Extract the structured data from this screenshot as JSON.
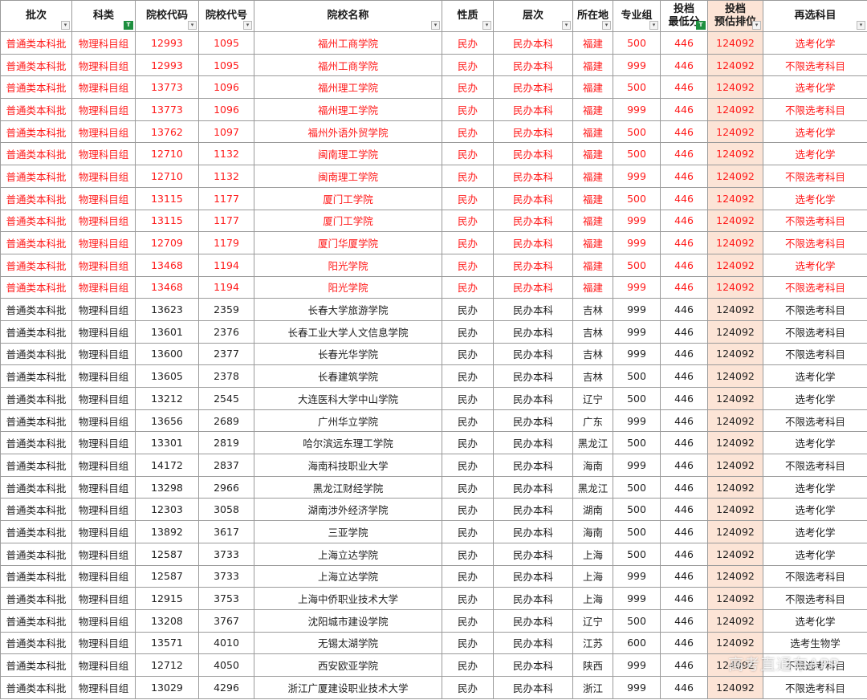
{
  "headers": [
    {
      "line1": "批次",
      "line2": "",
      "filter": "arrow"
    },
    {
      "line1": "科类",
      "line2": "",
      "filter": "active"
    },
    {
      "line1": "院校代码",
      "line2": "",
      "filter": "arrow"
    },
    {
      "line1": "院校代号",
      "line2": "",
      "filter": "arrow"
    },
    {
      "line1": "院校名称",
      "line2": "",
      "filter": "arrow"
    },
    {
      "line1": "性质",
      "line2": "",
      "filter": "arrow"
    },
    {
      "line1": "层次",
      "line2": "",
      "filter": "arrow"
    },
    {
      "line1": "所在地",
      "line2": "",
      "filter": "arrow"
    },
    {
      "line1": "专业组",
      "line2": "",
      "filter": "arrow"
    },
    {
      "line1": "投档",
      "line2": "最低分",
      "filter": "active"
    },
    {
      "line1": "投档",
      "line2": "预估排位",
      "filter": "arrow"
    },
    {
      "line1": "再选科目",
      "line2": "",
      "filter": "arrow"
    }
  ],
  "filter_icons": {
    "arrow": "▾",
    "active": "T"
  },
  "colors": {
    "highlight_text": "#ff1a1a",
    "rank_fill": "#fce4d6",
    "filter_active": "#1e8f3f"
  },
  "rows": [
    {
      "highlight": true,
      "cells": [
        "普通类本科批",
        "物理科目组",
        "12993",
        "1095",
        "福州工商学院",
        "民办",
        "民办本科",
        "福建",
        "500",
        "446",
        "124092",
        "选考化学"
      ]
    },
    {
      "highlight": true,
      "cells": [
        "普通类本科批",
        "物理科目组",
        "12993",
        "1095",
        "福州工商学院",
        "民办",
        "民办本科",
        "福建",
        "999",
        "446",
        "124092",
        "不限选考科目"
      ]
    },
    {
      "highlight": true,
      "cells": [
        "普通类本科批",
        "物理科目组",
        "13773",
        "1096",
        "福州理工学院",
        "民办",
        "民办本科",
        "福建",
        "500",
        "446",
        "124092",
        "选考化学"
      ]
    },
    {
      "highlight": true,
      "cells": [
        "普通类本科批",
        "物理科目组",
        "13773",
        "1096",
        "福州理工学院",
        "民办",
        "民办本科",
        "福建",
        "999",
        "446",
        "124092",
        "不限选考科目"
      ]
    },
    {
      "highlight": true,
      "cells": [
        "普通类本科批",
        "物理科目组",
        "13762",
        "1097",
        "福州外语外贸学院",
        "民办",
        "民办本科",
        "福建",
        "500",
        "446",
        "124092",
        "选考化学"
      ]
    },
    {
      "highlight": true,
      "cells": [
        "普通类本科批",
        "物理科目组",
        "12710",
        "1132",
        "闽南理工学院",
        "民办",
        "民办本科",
        "福建",
        "500",
        "446",
        "124092",
        "选考化学"
      ]
    },
    {
      "highlight": true,
      "cells": [
        "普通类本科批",
        "物理科目组",
        "12710",
        "1132",
        "闽南理工学院",
        "民办",
        "民办本科",
        "福建",
        "999",
        "446",
        "124092",
        "不限选考科目"
      ]
    },
    {
      "highlight": true,
      "cells": [
        "普通类本科批",
        "物理科目组",
        "13115",
        "1177",
        "厦门工学院",
        "民办",
        "民办本科",
        "福建",
        "500",
        "446",
        "124092",
        "选考化学"
      ]
    },
    {
      "highlight": true,
      "cells": [
        "普通类本科批",
        "物理科目组",
        "13115",
        "1177",
        "厦门工学院",
        "民办",
        "民办本科",
        "福建",
        "999",
        "446",
        "124092",
        "不限选考科目"
      ]
    },
    {
      "highlight": true,
      "cells": [
        "普通类本科批",
        "物理科目组",
        "12709",
        "1179",
        "厦门华厦学院",
        "民办",
        "民办本科",
        "福建",
        "999",
        "446",
        "124092",
        "不限选考科目"
      ]
    },
    {
      "highlight": true,
      "cells": [
        "普通类本科批",
        "物理科目组",
        "13468",
        "1194",
        "阳光学院",
        "民办",
        "民办本科",
        "福建",
        "500",
        "446",
        "124092",
        "选考化学"
      ]
    },
    {
      "highlight": true,
      "cells": [
        "普通类本科批",
        "物理科目组",
        "13468",
        "1194",
        "阳光学院",
        "民办",
        "民办本科",
        "福建",
        "999",
        "446",
        "124092",
        "不限选考科目"
      ]
    },
    {
      "highlight": false,
      "cells": [
        "普通类本科批",
        "物理科目组",
        "13623",
        "2359",
        "长春大学旅游学院",
        "民办",
        "民办本科",
        "吉林",
        "999",
        "446",
        "124092",
        "不限选考科目"
      ]
    },
    {
      "highlight": false,
      "cells": [
        "普通类本科批",
        "物理科目组",
        "13601",
        "2376",
        "长春工业大学人文信息学院",
        "民办",
        "民办本科",
        "吉林",
        "999",
        "446",
        "124092",
        "不限选考科目"
      ]
    },
    {
      "highlight": false,
      "cells": [
        "普通类本科批",
        "物理科目组",
        "13600",
        "2377",
        "长春光华学院",
        "民办",
        "民办本科",
        "吉林",
        "999",
        "446",
        "124092",
        "不限选考科目"
      ]
    },
    {
      "highlight": false,
      "cells": [
        "普通类本科批",
        "物理科目组",
        "13605",
        "2378",
        "长春建筑学院",
        "民办",
        "民办本科",
        "吉林",
        "500",
        "446",
        "124092",
        "选考化学"
      ]
    },
    {
      "highlight": false,
      "cells": [
        "普通类本科批",
        "物理科目组",
        "13212",
        "2545",
        "大连医科大学中山学院",
        "民办",
        "民办本科",
        "辽宁",
        "500",
        "446",
        "124092",
        "选考化学"
      ]
    },
    {
      "highlight": false,
      "cells": [
        "普通类本科批",
        "物理科目组",
        "13656",
        "2689",
        "广州华立学院",
        "民办",
        "民办本科",
        "广东",
        "999",
        "446",
        "124092",
        "不限选考科目"
      ]
    },
    {
      "highlight": false,
      "cells": [
        "普通类本科批",
        "物理科目组",
        "13301",
        "2819",
        "哈尔滨远东理工学院",
        "民办",
        "民办本科",
        "黑龙江",
        "500",
        "446",
        "124092",
        "选考化学"
      ]
    },
    {
      "highlight": false,
      "cells": [
        "普通类本科批",
        "物理科目组",
        "14172",
        "2837",
        "海南科技职业大学",
        "民办",
        "民办本科",
        "海南",
        "999",
        "446",
        "124092",
        "不限选考科目"
      ]
    },
    {
      "highlight": false,
      "cells": [
        "普通类本科批",
        "物理科目组",
        "13298",
        "2966",
        "黑龙江财经学院",
        "民办",
        "民办本科",
        "黑龙江",
        "500",
        "446",
        "124092",
        "选考化学"
      ]
    },
    {
      "highlight": false,
      "cells": [
        "普通类本科批",
        "物理科目组",
        "12303",
        "3058",
        "湖南涉外经济学院",
        "民办",
        "民办本科",
        "湖南",
        "500",
        "446",
        "124092",
        "选考化学"
      ]
    },
    {
      "highlight": false,
      "cells": [
        "普通类本科批",
        "物理科目组",
        "13892",
        "3617",
        "三亚学院",
        "民办",
        "民办本科",
        "海南",
        "500",
        "446",
        "124092",
        "选考化学"
      ]
    },
    {
      "highlight": false,
      "cells": [
        "普通类本科批",
        "物理科目组",
        "12587",
        "3733",
        "上海立达学院",
        "民办",
        "民办本科",
        "上海",
        "500",
        "446",
        "124092",
        "选考化学"
      ]
    },
    {
      "highlight": false,
      "cells": [
        "普通类本科批",
        "物理科目组",
        "12587",
        "3733",
        "上海立达学院",
        "民办",
        "民办本科",
        "上海",
        "999",
        "446",
        "124092",
        "不限选考科目"
      ]
    },
    {
      "highlight": false,
      "cells": [
        "普通类本科批",
        "物理科目组",
        "12915",
        "3753",
        "上海中侨职业技术大学",
        "民办",
        "民办本科",
        "上海",
        "999",
        "446",
        "124092",
        "不限选考科目"
      ]
    },
    {
      "highlight": false,
      "cells": [
        "普通类本科批",
        "物理科目组",
        "13208",
        "3767",
        "沈阳城市建设学院",
        "民办",
        "民办本科",
        "辽宁",
        "500",
        "446",
        "124092",
        "选考化学"
      ]
    },
    {
      "highlight": false,
      "cells": [
        "普通类本科批",
        "物理科目组",
        "13571",
        "4010",
        "无锡太湖学院",
        "民办",
        "民办本科",
        "江苏",
        "600",
        "446",
        "124092",
        "选考生物学"
      ]
    },
    {
      "highlight": false,
      "cells": [
        "普通类本科批",
        "物理科目组",
        "12712",
        "4050",
        "西安欧亚学院",
        "民办",
        "民办本科",
        "陕西",
        "999",
        "446",
        "124092",
        "不限选考科目"
      ]
    },
    {
      "highlight": false,
      "cells": [
        "普通类本科批",
        "物理科目组",
        "13029",
        "4296",
        "浙江广厦建设职业技术大学",
        "民办",
        "民办本科",
        "浙江",
        "999",
        "446",
        "124092",
        "不限选考科目"
      ]
    }
  ],
  "watermark": "高考直通车APP"
}
